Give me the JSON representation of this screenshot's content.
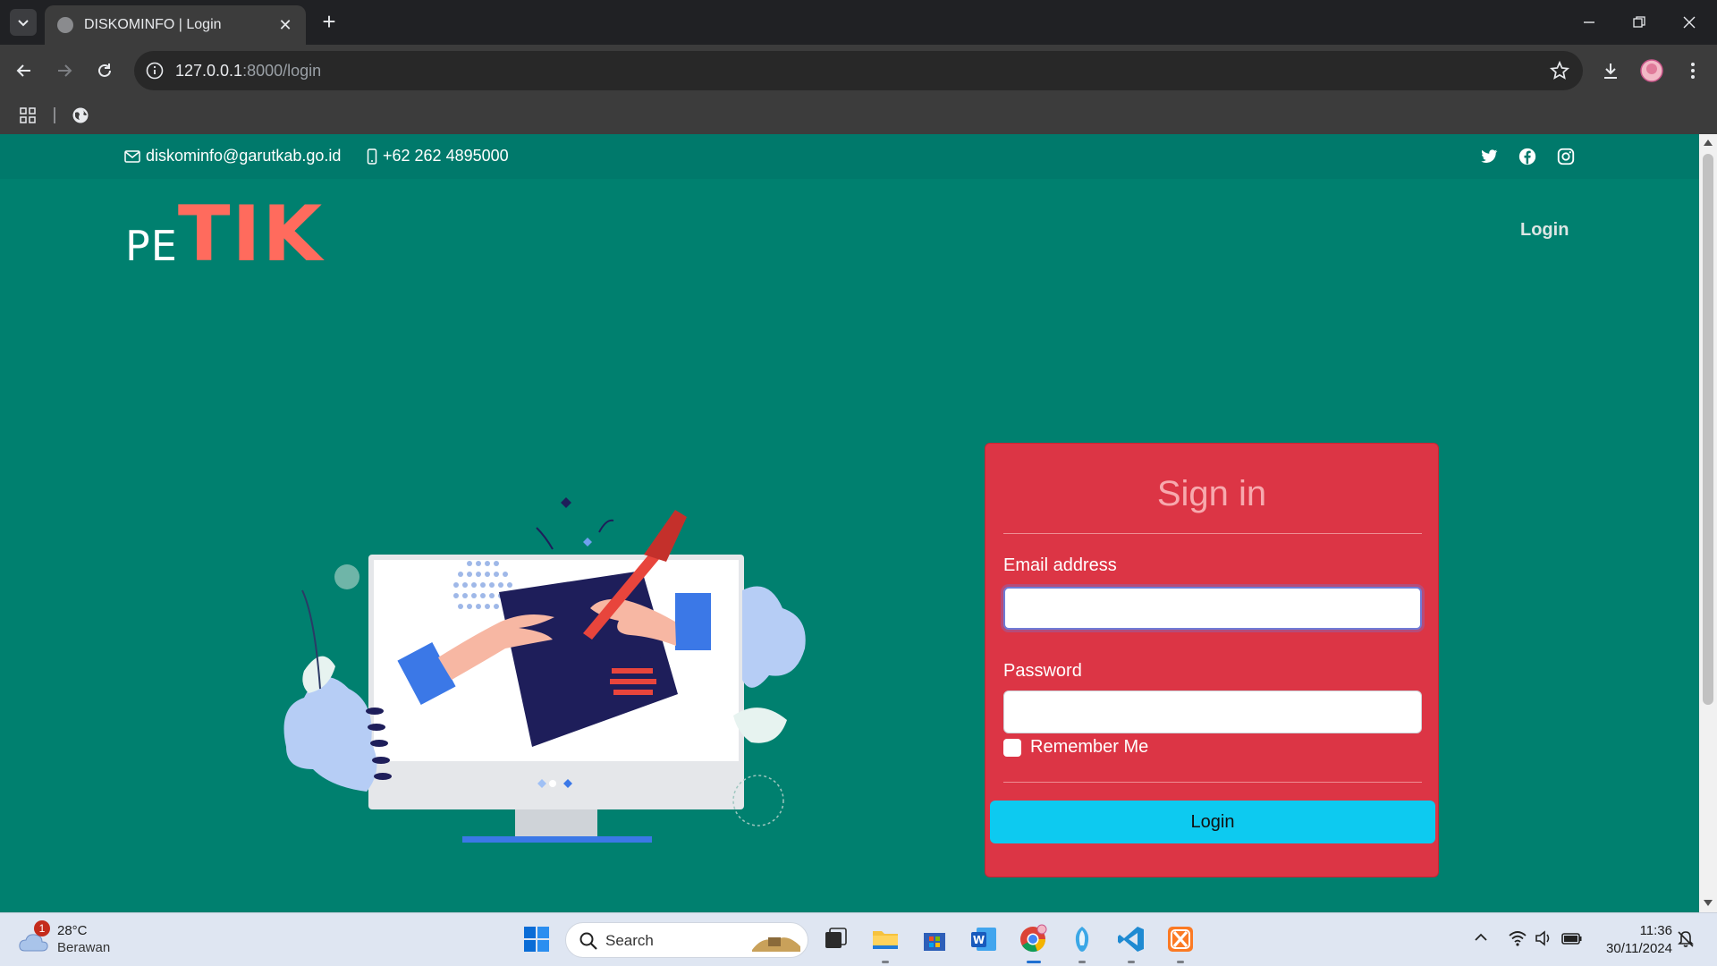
{
  "browser": {
    "tab_title": "DISKOMINFO | Login",
    "url_host": "127.0.0.1",
    "url_path": ":8000/login"
  },
  "topbar": {
    "email": "diskominfo@garutkab.go.id",
    "phone": "+62 262 4895000",
    "social_icons": [
      "twitter-icon",
      "facebook-icon",
      "instagram-icon"
    ]
  },
  "brand": {
    "logo_small": "PE",
    "logo_large": "TIK",
    "logo_large_color": "#ff6b5d"
  },
  "nav": {
    "login_label": "Login"
  },
  "signin": {
    "heading": "Sign in",
    "email_label": "Email address",
    "email_value": "",
    "password_label": "Password",
    "password_value": "",
    "remember_label": "Remember Me",
    "remember_checked": false,
    "submit_label": "Login",
    "card_color": "#dc3545",
    "button_color": "#0dcaf0"
  },
  "page": {
    "background_color": "#00806f"
  },
  "taskbar": {
    "weather_temp": "28°C",
    "weather_condition": "Berawan",
    "weather_badge": "1",
    "search_label": "Search",
    "clock_time": "11:36",
    "clock_date": "30/11/2024"
  }
}
